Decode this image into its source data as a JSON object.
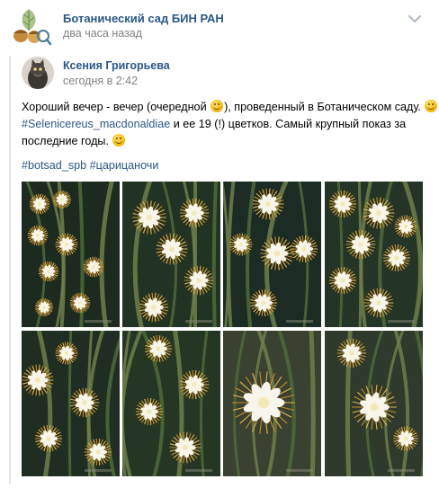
{
  "group": {
    "name": "Ботанический сад БИН РАН",
    "time": "два часа назад",
    "avatar_icon": "botanical-garden-logo-icon",
    "menu_icon": "chevron-down-icon"
  },
  "post": {
    "author": "Ксения Григорьева",
    "time": "сегодня в 2:42",
    "text": {
      "line1_before_emoji": "Хороший вечер - вечер (очередной ",
      "line1_after_emoji": "), проведенный в Ботаническом саду.",
      "line2_link": "#Selenicereus_macdonaldiae",
      "line2_rest": " и ее 19 (!) цветков. Самый крупный показ за",
      "line3": "последние годы."
    },
    "hashtags": [
      "#botsad_spb",
      "#царицаночи"
    ]
  },
  "photos": [
    {
      "alt": "photo-1"
    },
    {
      "alt": "photo-2"
    },
    {
      "alt": "photo-3"
    },
    {
      "alt": "photo-4"
    },
    {
      "alt": "photo-5"
    },
    {
      "alt": "photo-6"
    },
    {
      "alt": "photo-7"
    },
    {
      "alt": "photo-8"
    }
  ],
  "colors": {
    "link": "#2a5885",
    "muted": "#828282",
    "bar": "#dfe3e8"
  }
}
